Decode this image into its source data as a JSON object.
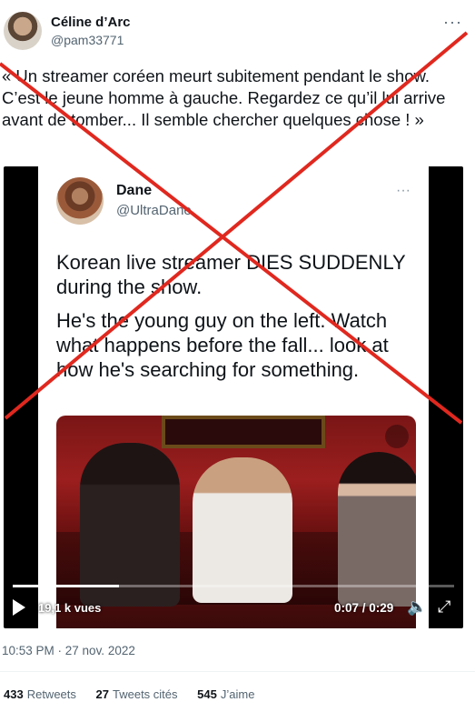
{
  "tweet": {
    "author_name": "Céline d’Arc",
    "author_handle": "@pam33771",
    "more_icon": "···",
    "text": "« Un streamer coréen meurt subitement pendant le show. C’est le jeune homme à gauche. Regardez ce qu’il lui arrive avant de tomber... Il semble chercher quelques chose ! »",
    "timestamp": "10:53 PM · 27 nov. 2022"
  },
  "embedded_tweet": {
    "author_name": "Dane",
    "author_handle": "@UltraDane",
    "more_icon": "···",
    "paragraph_1": "Korean live streamer DIES SUDDENLY during the show.",
    "paragraph_2": "He's the young guy on the left.  Watch what happens before the fall... look at how he's searching for something."
  },
  "video": {
    "views": "19,1 k vues",
    "time": "0:07 / 0:29",
    "progress_fraction": 0.24,
    "icons": [
      "play-icon",
      "volume-icon",
      "fullscreen-icon"
    ]
  },
  "stats": [
    {
      "count": "433",
      "label": "Retweets"
    },
    {
      "count": "27",
      "label": "Tweets cités"
    },
    {
      "count": "545",
      "label": "J’aime"
    }
  ],
  "overlay": {
    "cross_color": "#e0281f"
  }
}
